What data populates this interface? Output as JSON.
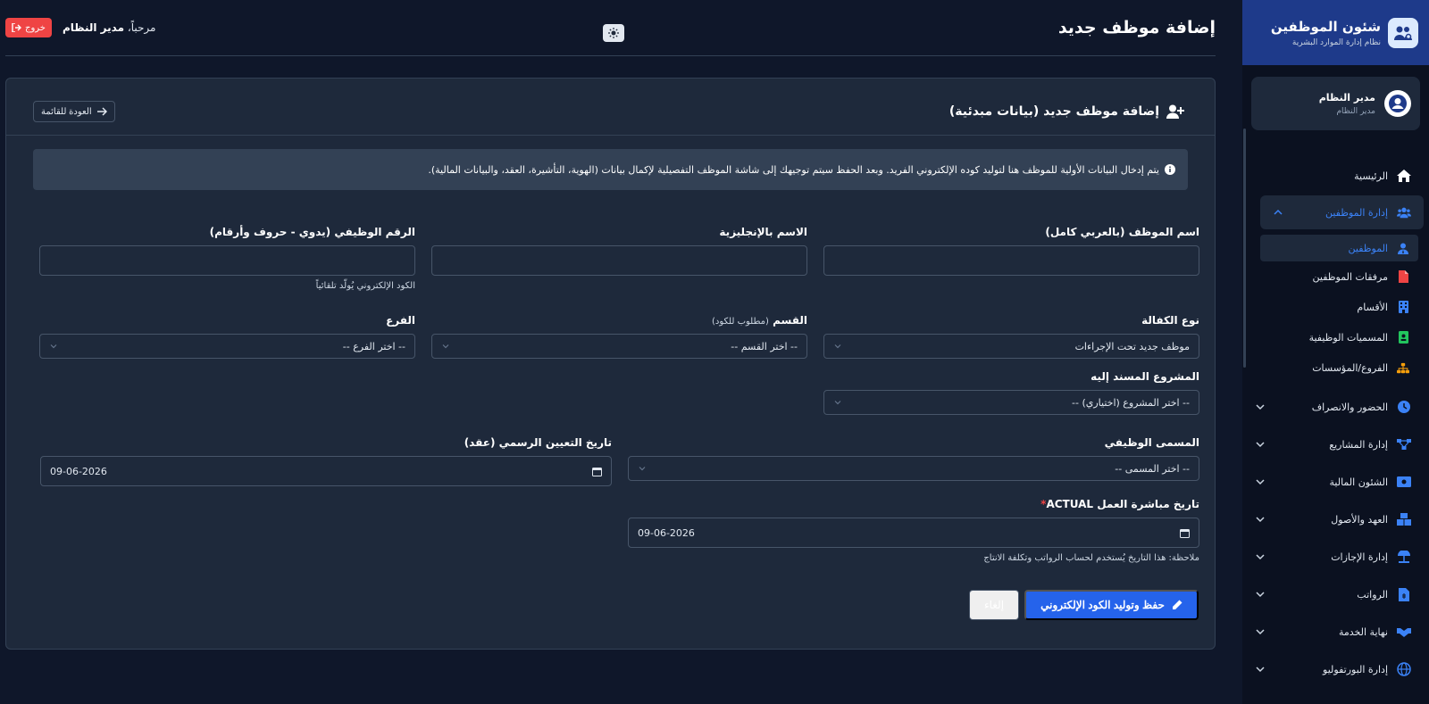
{
  "sidebar": {
    "brand_title": "شئون الموظفين",
    "brand_subtitle": "نظام إدارة الموارد البشرية",
    "user_name": "مدير النظام",
    "user_role": "مدير النظام",
    "home": "الرئيسية",
    "employees_mgmt": "إدارة الموظفين",
    "sub_items": [
      "الموظفين",
      "مرفقات الموظفين",
      "الأقسام",
      "المسميات الوظيفية",
      "الفروع/المؤسسات"
    ],
    "sections": [
      "الحضور والانصراف",
      "إدارة المشاريع",
      "الشئون المالية",
      "العهد والأصول",
      "إدارة الإجازات",
      "الرواتب",
      "نهاية الخدمة",
      "إدارة البورتفوليو"
    ]
  },
  "topbar": {
    "page_title": "إضافة موظف جديد",
    "welcome_prefix": "مرحباً،",
    "welcome_user": "مدير النظام",
    "logout": "خروج"
  },
  "card": {
    "title": "إضافة موظف جديد (بيانات مبدئية)",
    "back": "العودة للقائمة",
    "info": "يتم إدخال البيانات الأولية للموظف هنا لتوليد كوده الإلكتروني الفريد. وبعد الحفظ سيتم توجيهك إلى شاشة الموظف التفصيلية لإكمال بيانات (الهوية، التأشيرة، العقد، والبيانات المالية)."
  },
  "form": {
    "name_ar_label": "اسم الموظف (بالعربي كامل)",
    "name_en_label": "الاسم بالإنجليزية",
    "emp_no_label": "الرقم الوظيفي (يدوي - حروف وأرقام)",
    "emp_no_help": "الكود الإلكتروني يُولّد تلقائياً",
    "sponsorship_label": "نوع الكفالة",
    "sponsorship_value": "موظف جديد تحت الإجراءات",
    "dept_label": "القسم",
    "dept_note": "(مطلوب للكود)",
    "dept_value": "-- اختر القسم --",
    "branch_label": "الفرع",
    "branch_value": "-- اختر الفرع --",
    "project_label": "المشروع المسند إليه",
    "project_value": "-- اختر المشروع (اختياري) --",
    "title_label": "المسمى الوظيفي",
    "title_value": "-- اختر المسمى --",
    "hire_date_label": "تاريخ التعيين الرسمي (عقد)",
    "hire_date_value": "09-06-2026",
    "start_date_label": "تاريخ مباشرة العمل ACTUAL",
    "start_date_required": "*",
    "start_date_value": "09-06-2026",
    "start_date_help": "ملاحظة: هذا التاريخ يُستخدم لحساب الرواتب وتكلفة الانتاج",
    "save": "حفظ وتوليد الكود الإلكتروني",
    "cancel": "إلغاء"
  },
  "colors": {
    "accent": "#2563eb",
    "danger": "#ef4444",
    "background": "#0f172a",
    "card": "#1e293b"
  }
}
